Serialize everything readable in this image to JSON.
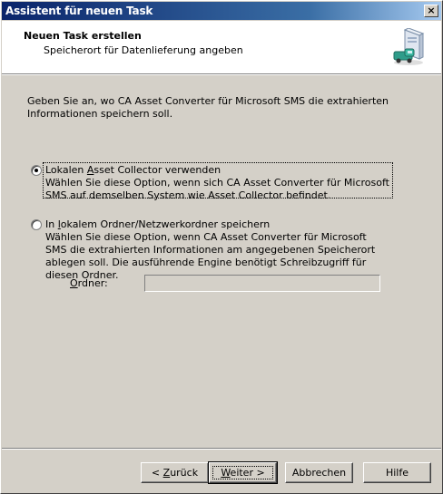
{
  "window": {
    "title": "Assistent für neuen Task",
    "close_glyph": "×"
  },
  "header": {
    "title": "Neuen Task erstellen",
    "subtitle": "Speicherort für Datenlieferung angeben",
    "icon": "computer-truck-icon"
  },
  "intro": "Geben Sie an, wo CA Asset Converter für Microsoft SMS die extrahierten Informationen speichern soll.",
  "options": [
    {
      "label_pre": "Lokalen ",
      "label_access": "A",
      "label_post": "sset Collector verwenden",
      "description": "Wählen Sie diese Option, wenn sich CA Asset Converter für  Microsoft SMS auf demselben System wie Asset Collector befindet.",
      "selected": true
    },
    {
      "label_pre": "In ",
      "label_access": "l",
      "label_post": "okalem Ordner/Netzwerkordner speichern",
      "description": "Wählen Sie diese Option, wenn CA Asset Converter für Microsoft SMS die extrahierten Informationen am angegebenen Speicherort ablegen soll. Die ausführende Engine benötigt Schreibzugriff für diesen Ordner.",
      "selected": false
    }
  ],
  "folder": {
    "label_access": "O",
    "label_post": "rdner:",
    "value": ""
  },
  "buttons": {
    "back_pre": "< ",
    "back_access": "Z",
    "back_post": "urück",
    "next_access": "W",
    "next_post": "eiter >",
    "cancel": "Abbrechen",
    "help": "Hilfe"
  }
}
